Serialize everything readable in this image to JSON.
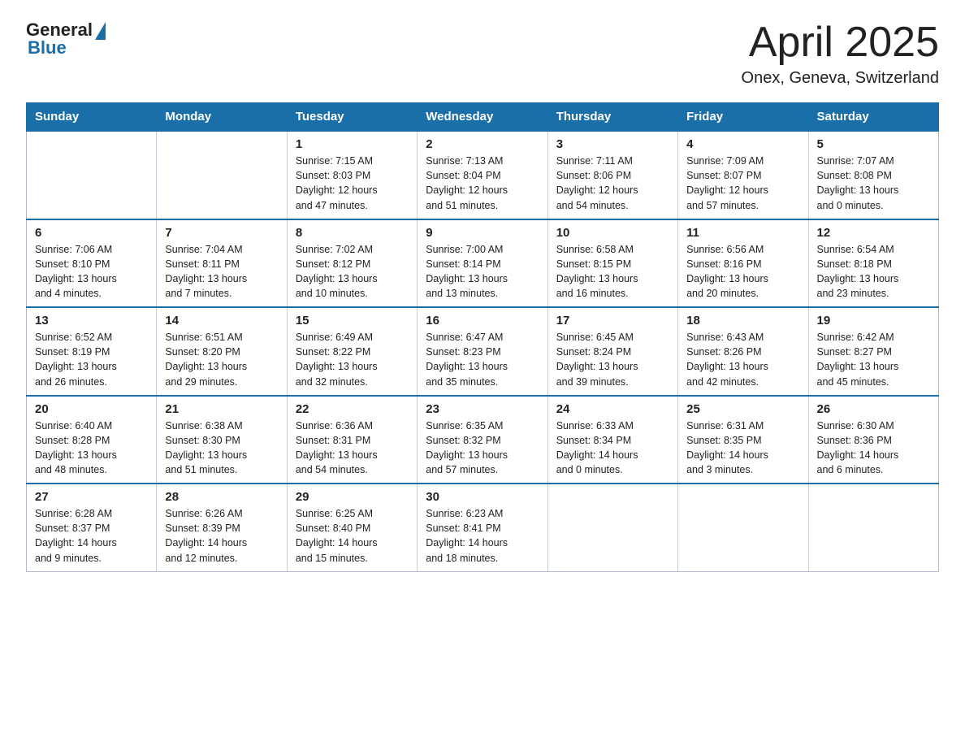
{
  "header": {
    "logo": {
      "general": "General",
      "blue": "Blue"
    },
    "title": "April 2025",
    "location": "Onex, Geneva, Switzerland"
  },
  "weekdays": [
    "Sunday",
    "Monday",
    "Tuesday",
    "Wednesday",
    "Thursday",
    "Friday",
    "Saturday"
  ],
  "weeks": [
    [
      {
        "day": "",
        "info": ""
      },
      {
        "day": "",
        "info": ""
      },
      {
        "day": "1",
        "info": "Sunrise: 7:15 AM\nSunset: 8:03 PM\nDaylight: 12 hours\nand 47 minutes."
      },
      {
        "day": "2",
        "info": "Sunrise: 7:13 AM\nSunset: 8:04 PM\nDaylight: 12 hours\nand 51 minutes."
      },
      {
        "day": "3",
        "info": "Sunrise: 7:11 AM\nSunset: 8:06 PM\nDaylight: 12 hours\nand 54 minutes."
      },
      {
        "day": "4",
        "info": "Sunrise: 7:09 AM\nSunset: 8:07 PM\nDaylight: 12 hours\nand 57 minutes."
      },
      {
        "day": "5",
        "info": "Sunrise: 7:07 AM\nSunset: 8:08 PM\nDaylight: 13 hours\nand 0 minutes."
      }
    ],
    [
      {
        "day": "6",
        "info": "Sunrise: 7:06 AM\nSunset: 8:10 PM\nDaylight: 13 hours\nand 4 minutes."
      },
      {
        "day": "7",
        "info": "Sunrise: 7:04 AM\nSunset: 8:11 PM\nDaylight: 13 hours\nand 7 minutes."
      },
      {
        "day": "8",
        "info": "Sunrise: 7:02 AM\nSunset: 8:12 PM\nDaylight: 13 hours\nand 10 minutes."
      },
      {
        "day": "9",
        "info": "Sunrise: 7:00 AM\nSunset: 8:14 PM\nDaylight: 13 hours\nand 13 minutes."
      },
      {
        "day": "10",
        "info": "Sunrise: 6:58 AM\nSunset: 8:15 PM\nDaylight: 13 hours\nand 16 minutes."
      },
      {
        "day": "11",
        "info": "Sunrise: 6:56 AM\nSunset: 8:16 PM\nDaylight: 13 hours\nand 20 minutes."
      },
      {
        "day": "12",
        "info": "Sunrise: 6:54 AM\nSunset: 8:18 PM\nDaylight: 13 hours\nand 23 minutes."
      }
    ],
    [
      {
        "day": "13",
        "info": "Sunrise: 6:52 AM\nSunset: 8:19 PM\nDaylight: 13 hours\nand 26 minutes."
      },
      {
        "day": "14",
        "info": "Sunrise: 6:51 AM\nSunset: 8:20 PM\nDaylight: 13 hours\nand 29 minutes."
      },
      {
        "day": "15",
        "info": "Sunrise: 6:49 AM\nSunset: 8:22 PM\nDaylight: 13 hours\nand 32 minutes."
      },
      {
        "day": "16",
        "info": "Sunrise: 6:47 AM\nSunset: 8:23 PM\nDaylight: 13 hours\nand 35 minutes."
      },
      {
        "day": "17",
        "info": "Sunrise: 6:45 AM\nSunset: 8:24 PM\nDaylight: 13 hours\nand 39 minutes."
      },
      {
        "day": "18",
        "info": "Sunrise: 6:43 AM\nSunset: 8:26 PM\nDaylight: 13 hours\nand 42 minutes."
      },
      {
        "day": "19",
        "info": "Sunrise: 6:42 AM\nSunset: 8:27 PM\nDaylight: 13 hours\nand 45 minutes."
      }
    ],
    [
      {
        "day": "20",
        "info": "Sunrise: 6:40 AM\nSunset: 8:28 PM\nDaylight: 13 hours\nand 48 minutes."
      },
      {
        "day": "21",
        "info": "Sunrise: 6:38 AM\nSunset: 8:30 PM\nDaylight: 13 hours\nand 51 minutes."
      },
      {
        "day": "22",
        "info": "Sunrise: 6:36 AM\nSunset: 8:31 PM\nDaylight: 13 hours\nand 54 minutes."
      },
      {
        "day": "23",
        "info": "Sunrise: 6:35 AM\nSunset: 8:32 PM\nDaylight: 13 hours\nand 57 minutes."
      },
      {
        "day": "24",
        "info": "Sunrise: 6:33 AM\nSunset: 8:34 PM\nDaylight: 14 hours\nand 0 minutes."
      },
      {
        "day": "25",
        "info": "Sunrise: 6:31 AM\nSunset: 8:35 PM\nDaylight: 14 hours\nand 3 minutes."
      },
      {
        "day": "26",
        "info": "Sunrise: 6:30 AM\nSunset: 8:36 PM\nDaylight: 14 hours\nand 6 minutes."
      }
    ],
    [
      {
        "day": "27",
        "info": "Sunrise: 6:28 AM\nSunset: 8:37 PM\nDaylight: 14 hours\nand 9 minutes."
      },
      {
        "day": "28",
        "info": "Sunrise: 6:26 AM\nSunset: 8:39 PM\nDaylight: 14 hours\nand 12 minutes."
      },
      {
        "day": "29",
        "info": "Sunrise: 6:25 AM\nSunset: 8:40 PM\nDaylight: 14 hours\nand 15 minutes."
      },
      {
        "day": "30",
        "info": "Sunrise: 6:23 AM\nSunset: 8:41 PM\nDaylight: 14 hours\nand 18 minutes."
      },
      {
        "day": "",
        "info": ""
      },
      {
        "day": "",
        "info": ""
      },
      {
        "day": "",
        "info": ""
      }
    ]
  ]
}
